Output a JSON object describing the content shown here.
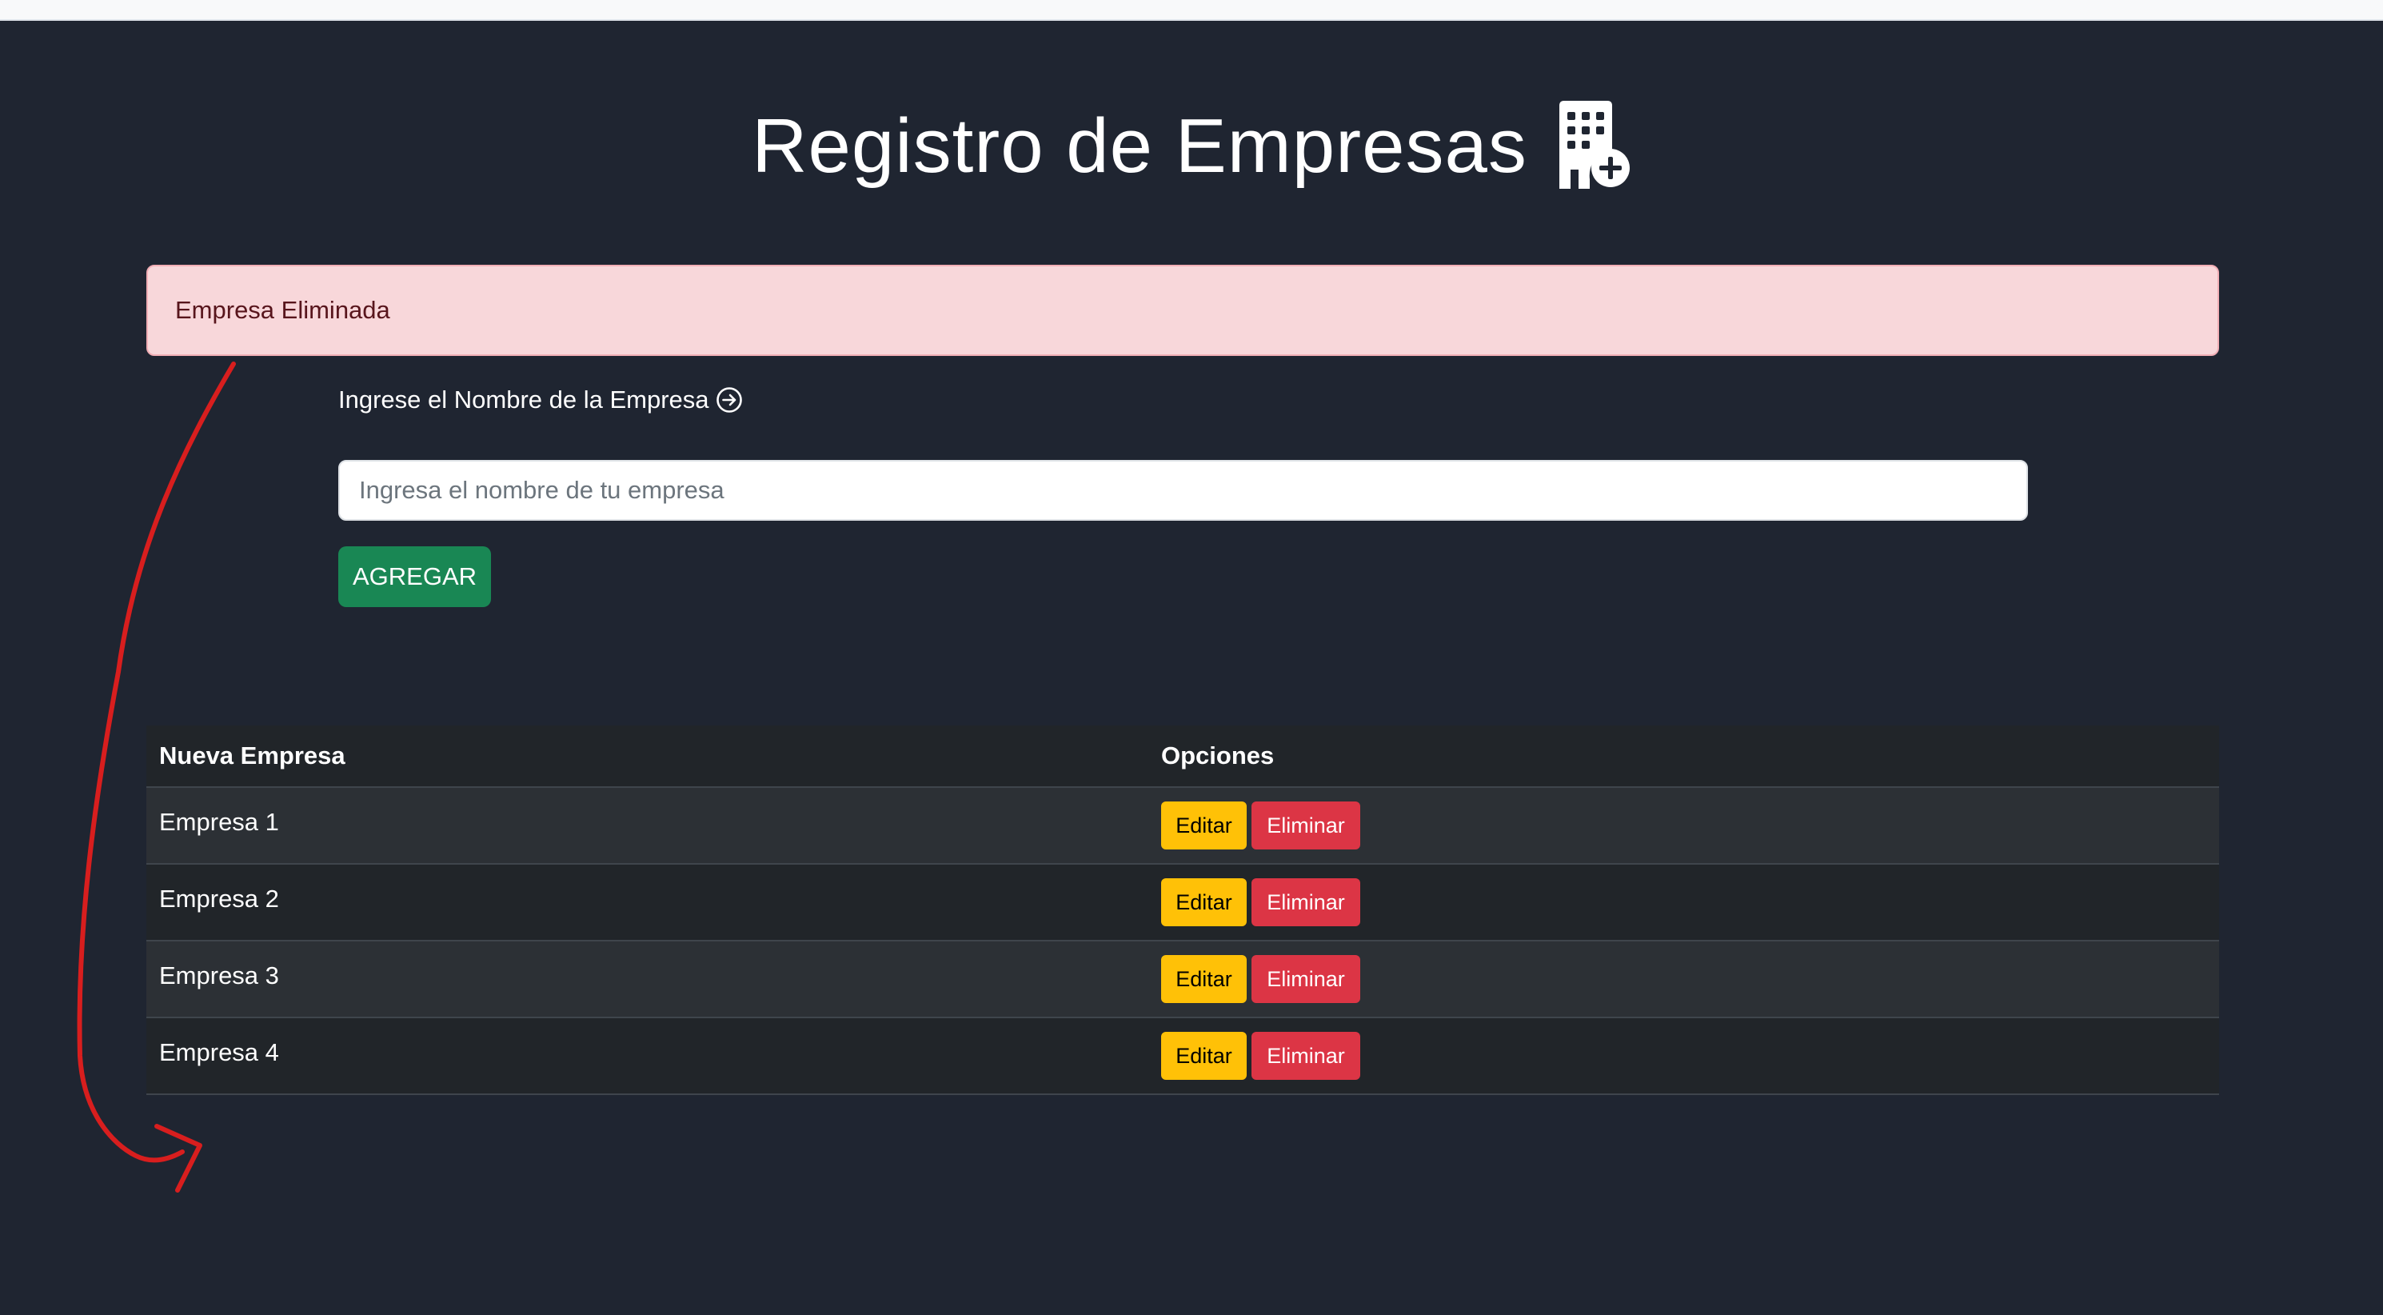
{
  "header": {
    "title": "Registro de Empresas",
    "icon": "building-add-icon"
  },
  "alert": {
    "message": "Empresa Eliminada",
    "color": "#f8d7da"
  },
  "form": {
    "label": "Ingrese el Nombre de la Empresa",
    "label_icon": "arrow-right-circle-icon",
    "input_value": "",
    "input_placeholder": "Ingresa el nombre de tu empresa",
    "add_label": "AGREGAR",
    "add_color": "#198754"
  },
  "table": {
    "headers": [
      "Nueva Empresa",
      "Opciones"
    ],
    "rows": [
      {
        "name": "Empresa 1",
        "edit_label": "Editar",
        "delete_label": "Eliminar"
      },
      {
        "name": "Empresa 2",
        "edit_label": "Editar",
        "delete_label": "Eliminar"
      },
      {
        "name": "Empresa 3",
        "edit_label": "Editar",
        "delete_label": "Eliminar"
      },
      {
        "name": "Empresa 4",
        "edit_label": "Editar",
        "delete_label": "Eliminar"
      }
    ],
    "edit_color": "#ffc107",
    "delete_color": "#dc3545"
  },
  "annotation": {
    "type": "hand-drawn-arrow",
    "color": "#d81e1e"
  }
}
